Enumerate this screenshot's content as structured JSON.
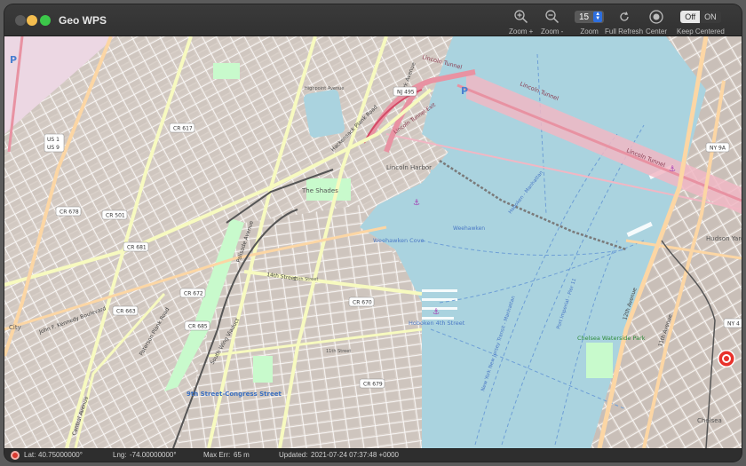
{
  "window": {
    "title": "Geo WPS"
  },
  "toolbar": {
    "zoom_in_label": "Zoom +",
    "zoom_out_label": "Zoom -",
    "zoom_value": "15",
    "zoom_label": "Zoom",
    "refresh_label": "Full Refresh",
    "center_label": "Center",
    "toggle_off": "Off",
    "toggle_on": "ON",
    "keep_centered_label": "Keep Centered",
    "keep_centered_state": "Off"
  },
  "map": {
    "labels": {
      "lincoln_tunnel_1": "Lincoln Tunnel",
      "lincoln_tunnel_2": "Lincoln Tunnel",
      "lincoln_tunnel_3": "Lincoln Tunnel",
      "lincoln_tunnel_exit": "Lincoln Tunnel Exit",
      "lincoln_harbor": "Lincoln Harbor",
      "the_shades": "The Shades",
      "weehawken_cove": "Weehawken Cove",
      "weehawken": "Weehawken",
      "hoboken_4th": "Hoboken 4th Street",
      "ninth_street": "9th Street-Congress Street",
      "chelsea_waterside": "Chelsea Waterside Park",
      "hudson_yards": "Hudson Yards",
      "chelsea": "Chelsea",
      "city": "City",
      "hoboken_manhattan": "Hoboken - Manhattan",
      "ny_nj_manhattan": "New York New Jersey Transit - Manhattan",
      "port_imperial": "Port Imperial - Pier 11",
      "twelfth_avenue": "12th Avenue",
      "eleventh_avenue": "11th Avenue",
      "palisade_avenue": "Palisade Avenue",
      "hackensack_plank": "Hackensack Plank Road",
      "park_avenue": "Park Avenue",
      "kennedy_blvd": "John F. Kennedy Boulevard",
      "central_avenue": "Central Avenue",
      "paterson_plank": "Paterson Plank Road",
      "south_wing_viaduct": "South Wing Viaduct",
      "fourteenth_street": "14th Street",
      "fifteenth_street": "15th Street",
      "eleventh_street": "11th Street",
      "highpoint_avenue": "Highpoint Avenue"
    },
    "shields": {
      "nj495": "NJ 495",
      "us1": "US 1",
      "us9": "US 9",
      "cr617": "CR 617",
      "cr678": "CR 678",
      "cr501": "CR 501",
      "cr681": "CR 681",
      "cr672": "CR 672",
      "cr663": "CR 663",
      "cr685": "CR 685",
      "cr670": "CR 670",
      "cr679": "CR 679",
      "ny9a": "NY 9A",
      "ny4": "NY 4"
    },
    "parking_marker": "P"
  },
  "status": {
    "lat_label": "Lat:",
    "lat_value": "40.75000000°",
    "lng_label": "Lng:",
    "lng_value": "-74.00000000°",
    "maxerr_label": "Max Err:",
    "maxerr_value": "65 m",
    "updated_label": "Updated:",
    "updated_value": "2021-07-24 07:37:48 +0000"
  },
  "colors": {
    "water": "#aad3df",
    "land": "#e3dcd3",
    "park": "#c8facc",
    "motorway": "#e892a2",
    "primary_road": "#fcd6a4",
    "secondary_road": "#f7fabf",
    "location_marker": "#e8322b"
  }
}
